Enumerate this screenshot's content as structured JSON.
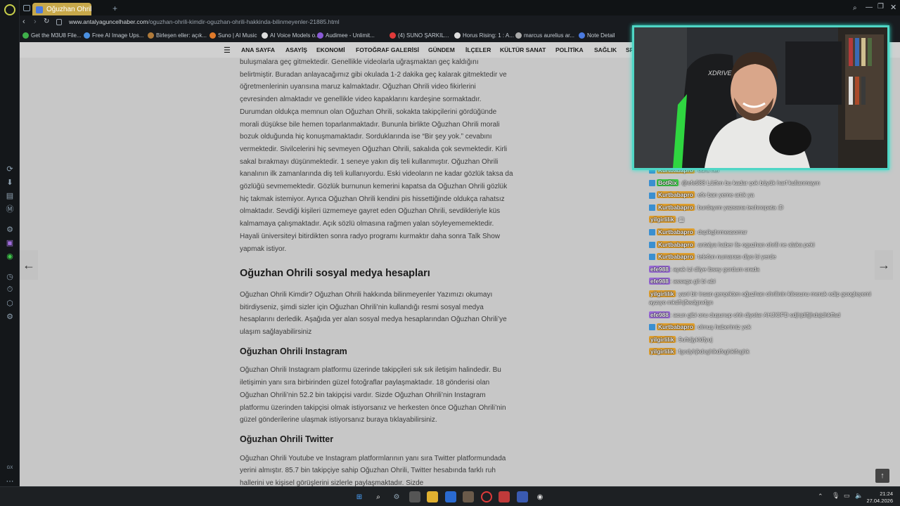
{
  "tab": {
    "title": "Oğuzhan Ohrili Kimdir? Oğ",
    "new_tab": "+"
  },
  "address": {
    "url_domain": "www.antalyaguncelhaber.com",
    "url_path": "/oguzhan-ohrili-kimdir-oguzhan-ohrili-hakkinda-bilinmeyenler-21885.html"
  },
  "bookmarks": [
    {
      "label": "Get the M3U8 File...",
      "color": "#3fb04a"
    },
    {
      "label": "Free AI Image Ups...",
      "color": "#4a8fe0"
    },
    {
      "label": "Birleşen eller: açık...",
      "color": "#b07a3a"
    },
    {
      "label": "Suno | AI Music",
      "color": "#e07a2a"
    },
    {
      "label": "AI Voice Models o...",
      "color": "#dddddd"
    },
    {
      "label": "Audimee - Unlimit...",
      "color": "#8a5ad6"
    },
    {
      "label": "(4) SUNO ŞARKIL...",
      "color": "#e03a3a"
    },
    {
      "label": "Horus Rising: 1 : A...",
      "color": "#dddddd"
    },
    {
      "label": "marcus aurelius ar...",
      "color": "#aaaaaa"
    },
    {
      "label": "Note Detail",
      "color": "#4a7ae0"
    }
  ],
  "nav": [
    "ANA SAYFA",
    "ASAYİŞ",
    "EKONOMİ",
    "FOTOĞRAF GALERİSİ",
    "GÜNDEM",
    "İLÇELER",
    "KÜLTÜR SANAT",
    "POLİTİKA",
    "SAĞLIK",
    "SP"
  ],
  "article": {
    "p1": "buluşmalara geç gitmektedir. Genellikle videolarla uğraşmaktan geç kaldığını belirtmiştir. Buradan anlayacağımız gibi okulada 1-2 dakika geç kalarak gitmektedir ve öğretmenlerinin uyarısına maruz kalmaktadır. Oğuzhan Ohrili video fikirlerini çevresinden almaktadır ve genellikle video kapaklarını kardeşine sormaktadır. Durumdan oldukça memnun olan Oğuzhan Ohrili, sokakta takipçilerini gördüğünde morali düşükse bile hemen toparlanmaktadır. Bununla birlikte Oğuzhan Ohrili morali bozuk olduğunda hiç konuşmamaktadır. Sorduklarında ise “Bir şey yok.” cevabını vermektedir. Sivilcelerini hiç sevmeyen Oğuzhan Ohrili, sakalıda çok sevmektedir. Kirli sakal bırakmayı düşünmektedir. 1 seneye yakın diş teli kullanmıştır. Oğuzhan Ohrili kanalının ilk zamanlarında diş teli kullanıyordu. Eski videoların ne kadar gözlük taksa da gözlüğü sevmemektedir. Gözlük burnunun kemerini kapatsa da Oğuzhan Ohrili gözlük hiç takmak istemiyor. Ayrıca Oğuzhan Ohrili kendini pis hissettiğinde oldukça rahatsız olmaktadır. Sevdiği kişileri üzmemeye gayret eden Oğuzhan Ohrili, sevdikleriyle küs kalmamaya çalışmaktadır. Açık sözlü olmasına rağmen yalan söyleyememektedir. Hayali üniversiteyi bitirdikten sonra radyo programı kurmaktır daha sonra Talk Show yapmak istiyor.",
    "h_social": "Oğuzhan Ohrili sosyal medya hesapları",
    "p2": "Oğuzhan Ohrili Kimdir? Oğuzhan Ohrili hakkında bilinmeyenler Yazımızı okumayı bitirdiyseniz, şimdi sizler için Oğuzhan Ohrili’nin kullandığı resmi sosyal medya hesaplarını derledik. Aşağıda yer alan sosyal medya hesaplarından Oğuzhan Ohrili’ye ulaşım sağlayabilirsiniz",
    "h_insta": "Oğuzhan Ohrili Instagram",
    "p3": "Oğuzhan Ohrili Instagram platformu üzerinde takipçileri sık sık iletişim halindedir. Bu iletişimin yanı sıra birbirinden güzel fotoğraflar paylaşmaktadır. 18 gönderisi olan Oğuzhan Ohrili’nin 52.2 bin takipçisi vardır. Sizde Oğuzhan Ohrili’nin Instagram platformu üzerinden takipçisi olmak istiyorsanız ve herkesten önce Oğuzhan Ohrili’nin güzel gönderilerine ulaşmak istiyorsanız buraya tıklayabilirsiniz.",
    "h_twitter": "Oğuzhan Ohrili Twitter",
    "p4": "Oğuzhan Ohrili Youtube ve Instagram platformlarının yanı sıra Twitter platformundada yerini almıştır. 85.7 bin takipçiye sahip Oğuzhan Ohrili, Twitter hesabında farklı ruh hallerini ve kişisel görüşlerini sizlerle paylaşmaktadır. Sizde"
  },
  "chat": [
    {
      "user": "Kurtbabapro",
      "color": "#e0a030",
      "badge": true,
      "text": ": oura ner"
    },
    {
      "user": "BotRix",
      "color": "#3fc94a",
      "badge": true,
      "text": ": @efe988 Lütfen bu kadar çok büyük harf kullanmayın"
    },
    {
      "user": "Kurtbabapro",
      "color": "#e0a030",
      "badge": true,
      "text": ": efe ban yeme artık ya"
    },
    {
      "user": "Kurtbabapro",
      "color": "#e0a030",
      "badge": true,
      "text": ": burdayım yazsana technopata :D"
    },
    {
      "user": "yilgirlilik",
      "color": "#e0a030",
      "badge": false,
      "text": ": ▩"
    },
    {
      "user": "Kurtbabapro",
      "color": "#e0a030",
      "badge": true,
      "text": ": dspikghrmeasomsr"
    },
    {
      "user": "Kurtbabapro",
      "color": "#e0a030",
      "badge": true,
      "text": ": antalya haber ile oguzhan ohrili ne alaka peki"
    },
    {
      "user": "Kurtbabapro",
      "color": "#e0a030",
      "badge": true,
      "text": ": telefon numarası diyo bi yerde"
    },
    {
      "user": "efe988",
      "color": "#9a6ad8",
      "badge": false,
      "text": ": ayak izi diiye ibsey gordum orada"
    },
    {
      "user": "efe988",
      "color": "#9a6ad8",
      "badge": false,
      "text": ": assaga git bi abi"
    },
    {
      "user": "yilgirlilik",
      "color": "#e0a030",
      "badge": false,
      "text": ": yani bir insan gerçekten oğuzhan ohrilinin kilosunu merak edip googleyemi ayzıyo mkdfhjfksdgnxfgn"
    },
    {
      "user": "efe988",
      "color": "#9a6ad8",
      "badge": false,
      "text": ": acun gibi onu duşunup ohh diyolar AHJIOFD sdjhjdlfjjhdsjdhkffsd"
    },
    {
      "user": "Kurtbabapro",
      "color": "#e0a030",
      "badge": true,
      "text": ": olmuş haberimiz yok"
    },
    {
      "user": "yilgirlilik",
      "color": "#e0a030",
      "badge": false,
      "text": ": 9uftdjykldfyuj"
    },
    {
      "user": "yilgirlilik",
      "color": "#e0a030",
      "badge": false,
      "text": ": fgcdyhjkdcghlkdfcghklfcghk"
    }
  ],
  "clock": {
    "time": "21:24",
    "date": "27.04.2026"
  },
  "sidebar_label": "GX",
  "webcam": {
    "chair_brand": "XDRIVE"
  }
}
